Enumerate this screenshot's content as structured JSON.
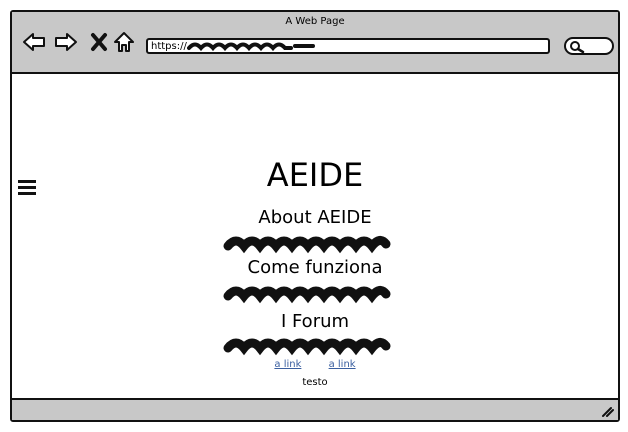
{
  "window": {
    "title": "A Web Page"
  },
  "toolbar": {
    "back_icon": "arrow-left-icon",
    "forward_icon": "arrow-right-icon",
    "stop_icon": "close-icon",
    "home_icon": "home-icon",
    "url_prefix": "https://",
    "search_icon": "search-icon"
  },
  "page": {
    "menu_icon": "hamburger-icon",
    "title": "AEIDE",
    "sections": [
      {
        "heading": "About AEIDE"
      },
      {
        "heading": "Come funziona"
      },
      {
        "heading": "I Forum"
      }
    ],
    "links": [
      "a link",
      "a link"
    ],
    "footer_text": "testo"
  },
  "colors": {
    "chrome": "#c8c8c8",
    "link": "#3a5fa0",
    "ink": "#111111"
  }
}
